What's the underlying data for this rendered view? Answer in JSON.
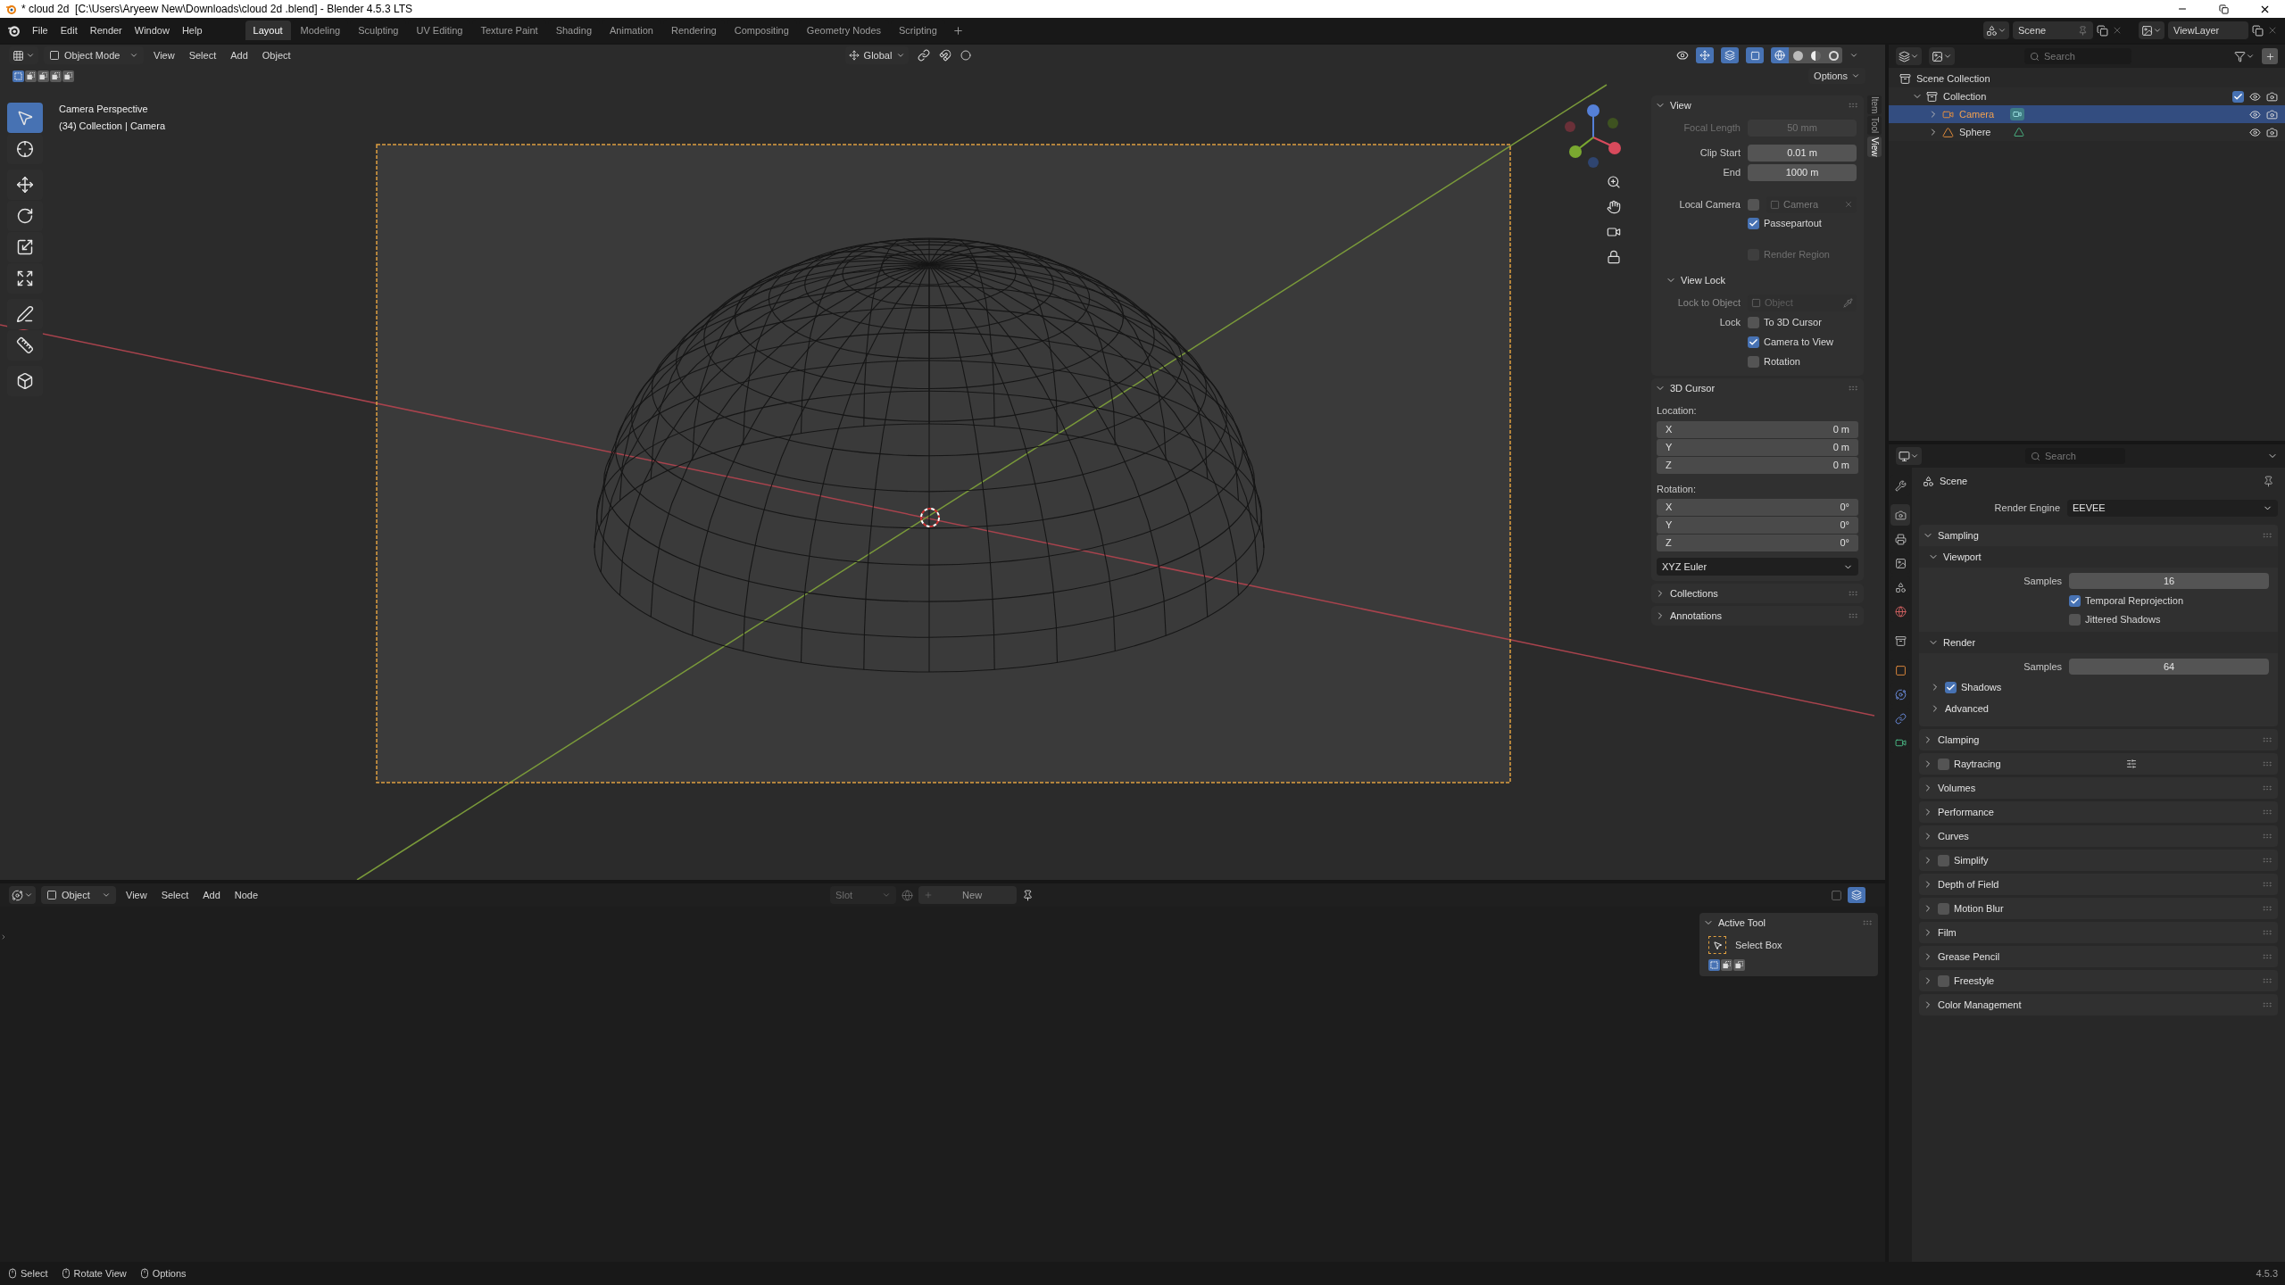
{
  "title_bar": {
    "title": "* cloud 2d  [C:\\Users\\Aryeew New\\Downloads\\cloud 2d .blend] - Blender 4.5.3 LTS"
  },
  "menu_bar": {
    "menus": [
      "File",
      "Edit",
      "Render",
      "Window",
      "Help"
    ],
    "workspaces": [
      {
        "label": "Layout",
        "selected": true
      },
      {
        "label": "Modeling",
        "selected": false
      },
      {
        "label": "Sculpting",
        "selected": false
      },
      {
        "label": "UV Editing",
        "selected": false
      },
      {
        "label": "Texture Paint",
        "selected": false
      },
      {
        "label": "Shading",
        "selected": false
      },
      {
        "label": "Animation",
        "selected": false
      },
      {
        "label": "Rendering",
        "selected": false
      },
      {
        "label": "Compositing",
        "selected": false
      },
      {
        "label": "Geometry Nodes",
        "selected": false
      },
      {
        "label": "Scripting",
        "selected": false
      }
    ],
    "scene": "Scene",
    "view_layer": "ViewLayer"
  },
  "viewport": {
    "mode": "Object Mode",
    "menus": [
      "View",
      "Select",
      "Add",
      "Object"
    ],
    "orientation": "Global",
    "options": "Options",
    "select_modes": [
      {
        "selected": true
      },
      {
        "selected": false
      },
      {
        "selected": false
      },
      {
        "selected": false
      },
      {
        "selected": false
      }
    ],
    "shading": [
      {
        "kind": "wireframe",
        "selected": true
      },
      {
        "kind": "solid",
        "selected": false
      },
      {
        "kind": "material",
        "selected": false
      },
      {
        "kind": "rendered",
        "selected": false
      }
    ],
    "tools": [
      {
        "kind": "select",
        "selected": true
      },
      {
        "kind": "cursor",
        "selected": false
      },
      {
        "kind": "move",
        "selected": false
      },
      {
        "kind": "rotate",
        "selected": false
      },
      {
        "kind": "scale",
        "selected": false
      },
      {
        "kind": "transform",
        "selected": false
      },
      {
        "kind": "annotate",
        "selected": false
      },
      {
        "kind": "measure",
        "selected": false
      },
      {
        "kind": "add_cube",
        "selected": false
      }
    ],
    "info": [
      "Camera Perspective",
      "(34) Collection | Camera"
    ]
  },
  "sidebar": {
    "tabs": [
      {
        "label": "Item",
        "selected": false
      },
      {
        "label": "Tool",
        "selected": false
      },
      {
        "label": "View",
        "selected": true
      }
    ],
    "view": {
      "title": "View",
      "expanded": true,
      "fields": [
        {
          "label": "Focal Length",
          "value": "50 mm",
          "disabled": true
        },
        {
          "label": "Clip Start",
          "value": "0.01 m",
          "disabled": false
        },
        {
          "label": "End",
          "value": "1000 m",
          "disabled": false
        }
      ],
      "local_camera": {
        "label": "Local Camera",
        "checked": false,
        "placeholder": "Camera"
      },
      "options": [
        {
          "label": "Passepartout",
          "checked": true,
          "disabled": false
        },
        {
          "label": "Render Region",
          "checked": false,
          "disabled": true
        }
      ]
    },
    "view_lock": {
      "title": "View Lock",
      "expanded": true,
      "object": {
        "label": "Lock to Object",
        "placeholder": "Object"
      },
      "lock_label": "Lock",
      "options": [
        {
          "label": "To 3D Cursor",
          "checked": false
        },
        {
          "label": "Camera to View",
          "checked": true
        },
        {
          "label": "Rotation",
          "checked": false
        }
      ]
    },
    "cursor": {
      "title": "3D Cursor",
      "expanded": true,
      "location_label": "Location:",
      "location": [
        {
          "axis": "X",
          "value": "0 m"
        },
        {
          "axis": "Y",
          "value": "0 m"
        },
        {
          "axis": "Z",
          "value": "0 m"
        }
      ],
      "rotation_label": "Rotation:",
      "rotation": [
        {
          "axis": "X",
          "value": "0°"
        },
        {
          "axis": "Y",
          "value": "0°"
        },
        {
          "axis": "Z",
          "value": "0°"
        }
      ],
      "rotation_mode": "XYZ Euler"
    },
    "collapsed": [
      {
        "title": "Collections",
        "expanded": false
      },
      {
        "title": "Annotations",
        "expanded": false
      }
    ]
  },
  "node_editor": {
    "object": "Object",
    "menus": [
      "View",
      "Select",
      "Add",
      "Node"
    ],
    "slot": "Slot",
    "new": "New",
    "active_tool": {
      "title": "Active Tool",
      "expanded": true,
      "tool": "Select Box",
      "modes": [
        {
          "selected": true
        },
        {
          "selected": false
        },
        {
          "selected": false
        }
      ]
    }
  },
  "outliner": {
    "search_placeholder": "Search",
    "tree": [
      {
        "label": "Scene Collection",
        "kind": "scene_collection",
        "selected": false,
        "children": [
          {
            "label": "Collection",
            "kind": "collection",
            "expanded": true,
            "checked": true,
            "selected": false,
            "children": [
              {
                "label": "Camera",
                "kind": "camera",
                "expanded": false,
                "selected": true
              },
              {
                "label": "Sphere",
                "kind": "mesh",
                "expanded": false,
                "selected": false
              }
            ]
          }
        ]
      }
    ]
  },
  "properties": {
    "search_placeholder": "Search",
    "tabs": [
      {
        "kind": "tool",
        "selected": false
      },
      {
        "kind": "render",
        "selected": true
      },
      {
        "kind": "output",
        "selected": false
      },
      {
        "kind": "view_layer",
        "selected": false
      },
      {
        "kind": "scene",
        "selected": false
      },
      {
        "kind": "world",
        "selected": false
      },
      {
        "kind": "collection",
        "selected": false
      },
      {
        "kind": "object",
        "selected": false
      },
      {
        "kind": "physics",
        "selected": false
      },
      {
        "kind": "constraints",
        "selected": false
      },
      {
        "kind": "data",
        "selected": false
      }
    ],
    "context": "Scene",
    "render_engine": {
      "label": "Render Engine",
      "value": "EEVEE"
    },
    "panels": [
      {
        "title": "Sampling",
        "expanded": true,
        "subpanels": [
          {
            "title": "Viewport",
            "expanded": true,
            "samples": {
              "label": "Samples",
              "value": "16"
            },
            "options": [
              {
                "label": "Temporal Reprojection",
                "checked": true
              },
              {
                "label": "Jittered Shadows",
                "checked": false
              }
            ]
          },
          {
            "title": "Render",
            "expanded": true,
            "samples": {
              "label": "Samples",
              "value": "64"
            },
            "subpanels": [
              {
                "title": "Shadows",
                "expanded": false,
                "checked": true
              },
              {
                "title": "Advanced",
                "expanded": false
              }
            ]
          }
        ]
      },
      {
        "title": "Clamping",
        "expanded": false
      },
      {
        "title": "Raytracing",
        "expanded": false,
        "checked": false
      },
      {
        "title": "Volumes",
        "expanded": false
      },
      {
        "title": "Performance",
        "expanded": false
      },
      {
        "title": "Curves",
        "expanded": false
      },
      {
        "title": "Simplify",
        "expanded": false,
        "checked": false
      },
      {
        "title": "Depth of Field",
        "expanded": false
      },
      {
        "title": "Motion Blur",
        "expanded": false,
        "checked": false
      },
      {
        "title": "Film",
        "expanded": false
      },
      {
        "title": "Grease Pencil",
        "expanded": false
      },
      {
        "title": "Freestyle",
        "expanded": false,
        "checked": false
      },
      {
        "title": "Color Management",
        "expanded": false
      }
    ]
  },
  "status_bar": {
    "hints": [
      "Select",
      "Rotate View",
      "Options"
    ],
    "version": "4.5.3"
  }
}
